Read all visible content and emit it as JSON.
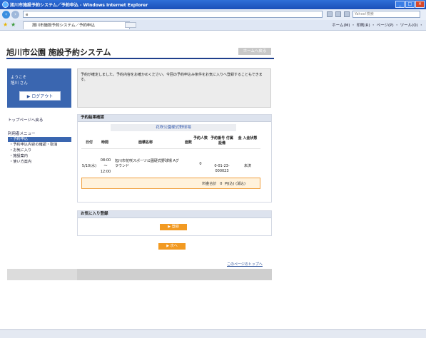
{
  "browser": {
    "title": "旭川市施設予約システム／予約申込 - Windows Internet Explorer",
    "url": "e",
    "search_placeholder": "Yahoo!検索",
    "tab_label": "旭川市施設予約システム／予約申込",
    "command_bar": "ホーム(M) ・ 印刷(R) ・ ページ(P) ・ ツール(O) ・"
  },
  "header": {
    "site_title": "旭川市公園 施設予約システム",
    "home_button": "ホームへ戻る"
  },
  "sidebar": {
    "welcome_line1": "ようこそ",
    "welcome_line2": "旭川 さん",
    "logout_label": "▶ ログアウト",
    "top_link": "トップページへ戻る",
    "menu_heading": "利用者メニュー",
    "items": [
      {
        "label": "・予約申込",
        "active": true
      },
      {
        "label": "・予約申込内容の確認・取消",
        "active": false
      },
      {
        "label": "・お気に入り",
        "active": false
      },
      {
        "label": "・施設案内",
        "active": false
      },
      {
        "label": "・使い方案内",
        "active": false
      }
    ]
  },
  "message": {
    "text": "予約が確定しました。予約内容をお確かめください。今回の予約申込み条件をお気に入りへ登録することもできます。"
  },
  "result": {
    "heading": "予約結果確認",
    "facility": "花咲公園硬式野球場",
    "columns": [
      "日付",
      "時間",
      "面積名称",
      "面数",
      "予約人数",
      "予約番号 付属設備",
      "金 入金状態"
    ],
    "row": {
      "date": "5/10(水)",
      "time": "08:00 ～ 12:00",
      "area": "旭川市花咲スポーツ公園硬式野球場 Aグラウンド",
      "count": "",
      "people": "0",
      "number": "0-01-23-000023",
      "status": "未済"
    },
    "total_label": "料金合計",
    "total_value": "0",
    "total_suffix": "円(込) (消込)"
  },
  "favorite": {
    "heading": "お気に入り登録",
    "register_button": "▶ 登録"
  },
  "next_button": "▶ 次へ",
  "page_top_link": "このページのトップへ"
}
